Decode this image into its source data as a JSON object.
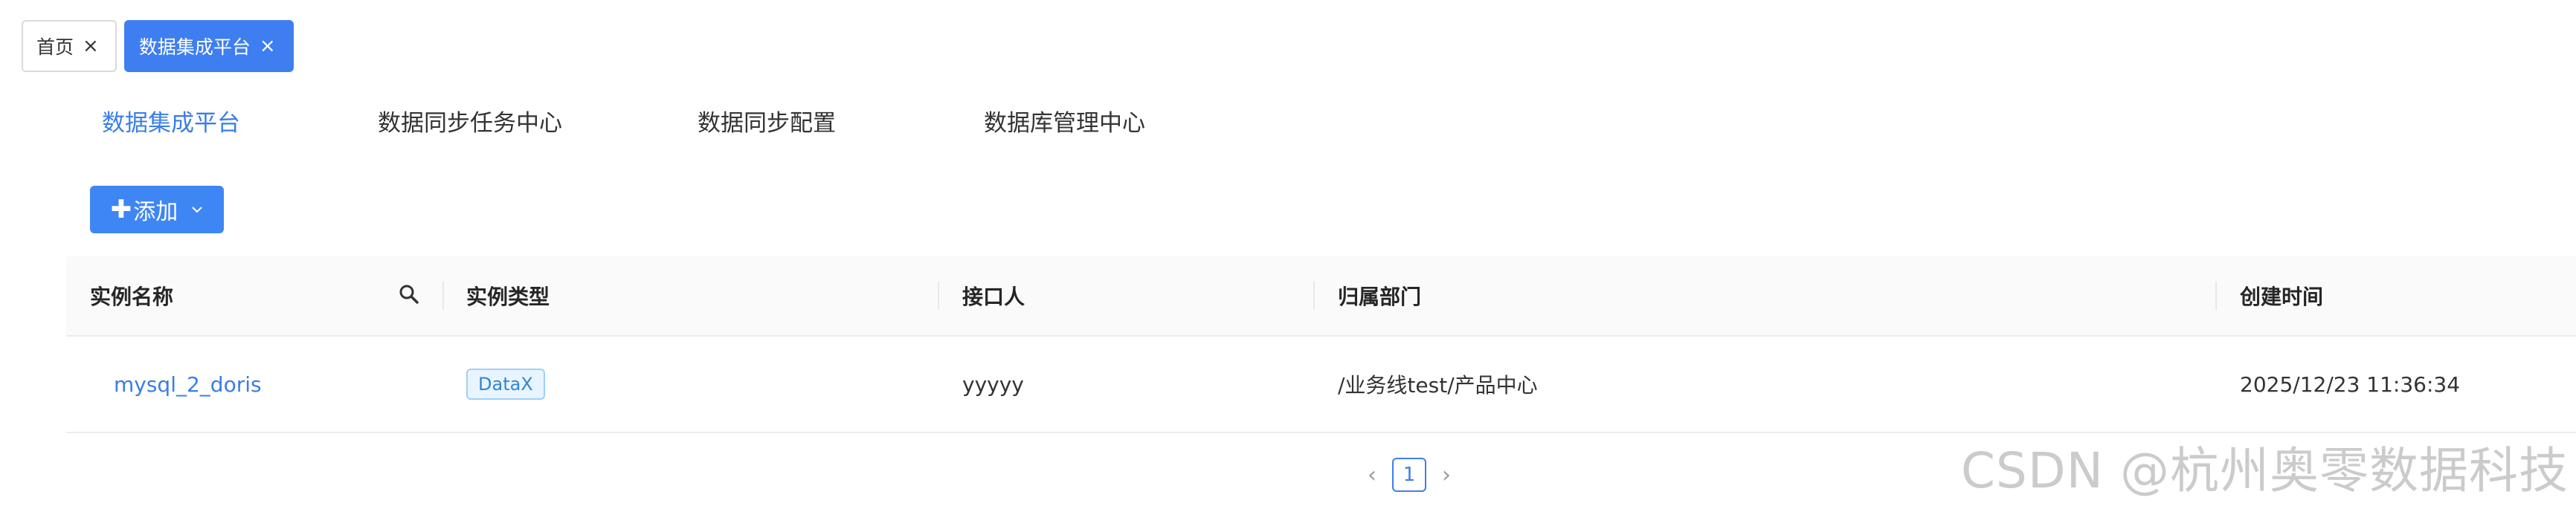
{
  "tags": [
    {
      "label": "首页",
      "close": "×"
    },
    {
      "label": "数据集成平台",
      "close": "×"
    }
  ],
  "subnav": {
    "items": [
      "数据集成平台",
      "数据同步任务中心",
      "数据同步配置",
      "数据库管理中心"
    ],
    "active_index": 0
  },
  "toolbar": {
    "add_plus": "✚",
    "add_label": "添加"
  },
  "table": {
    "columns": [
      "实例名称",
      "实例类型",
      "接口人",
      "归属部门",
      "创建时间"
    ],
    "rows": [
      {
        "name": "mysql_2_doris",
        "type": "DataX",
        "contact": "yyyyy",
        "department": "/业务线test/产品中心",
        "created_at": "2025/12/23 11:36:34"
      }
    ]
  },
  "pagination": {
    "prev": "‹",
    "current": "1",
    "next": "›"
  },
  "watermark": "CSDN @杭州奥零数据科技",
  "colors": {
    "primary": "#3f7ef0",
    "link": "#3a7de6",
    "tag_bg": "#e8f4ff"
  }
}
